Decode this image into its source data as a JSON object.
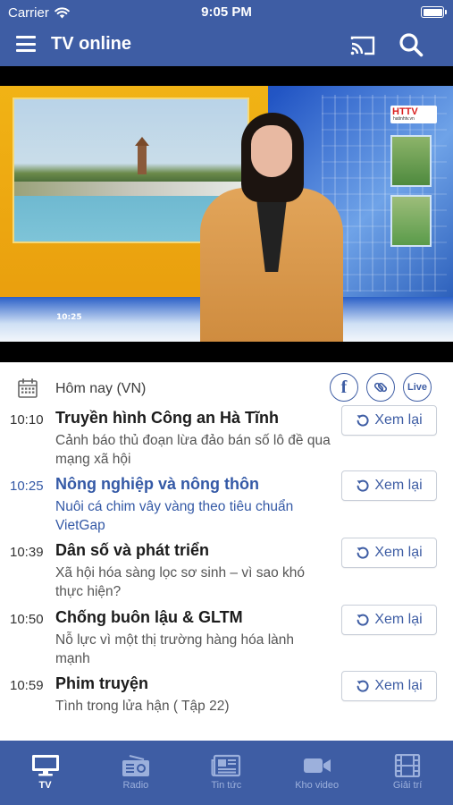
{
  "status_bar": {
    "carrier": "Carrier",
    "time": "9:05 PM"
  },
  "header": {
    "title": "TV online"
  },
  "video": {
    "timestamp": "10:25",
    "logo": "HTTV",
    "logo_sub": "hatinhtv.vn"
  },
  "schedule": {
    "date_label": "Hôm nay (VN)",
    "live_label": "Live",
    "facebook_label": "f",
    "replay_label": "Xem lại",
    "programs": [
      {
        "time": "10:10",
        "title": "Truyền hình Công an Hà Tĩnh",
        "desc": "Cảnh báo thủ đoạn lừa đảo bán số lô đề qua mạng xã hội",
        "active": false
      },
      {
        "time": "10:25",
        "title": "Nông nghiệp và nông thôn",
        "desc": "Nuôi cá chim vây vàng theo tiêu chuẩn VietGap",
        "active": true
      },
      {
        "time": "10:39",
        "title": "Dân số và phát triển",
        "desc": "Xã hội hóa sàng lọc sơ sinh – vì sao khó thực hiện?",
        "active": false
      },
      {
        "time": "10:50",
        "title": "Chống buôn lậu & GLTM",
        "desc": "Nỗ lực vì một thị trường hàng hóa lành mạnh",
        "active": false
      },
      {
        "time": "10:59",
        "title": "Phim truyện",
        "desc": "Tình trong lửa hận ( Tập 22)",
        "active": false
      }
    ]
  },
  "tabbar": {
    "items": [
      {
        "label": "TV",
        "icon": "tv-icon",
        "active": true
      },
      {
        "label": "Radio",
        "icon": "radio-icon",
        "active": false
      },
      {
        "label": "Tin tức",
        "icon": "newspaper-icon",
        "active": false
      },
      {
        "label": "Kho video",
        "icon": "video-camera-icon",
        "active": false
      },
      {
        "label": "Giải trí",
        "icon": "film-icon",
        "active": false
      }
    ]
  },
  "colors": {
    "brand": "#3e5da4",
    "active_text": "#3459a6",
    "tab_inactive": "#9cb0dc"
  }
}
